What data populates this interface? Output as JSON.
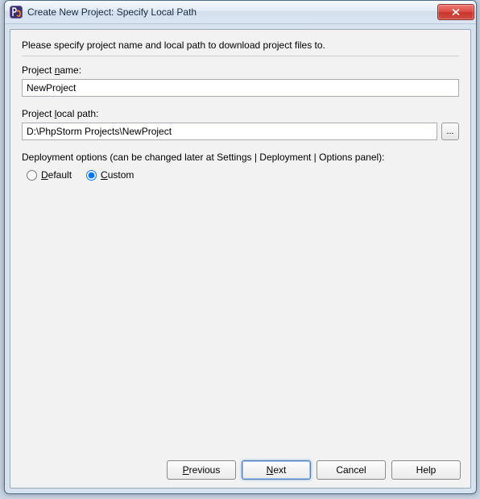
{
  "window": {
    "title": "Create New Project: Specify Local Path"
  },
  "intro": "Please specify project name and local path to download project files to.",
  "project_name": {
    "label_pre": "Project ",
    "label_mn": "n",
    "label_post": "ame:",
    "value": "NewProject"
  },
  "project_path": {
    "label_pre": "Project ",
    "label_mn": "l",
    "label_post": "ocal path:",
    "value": "D:\\PhpStorm Projects\\NewProject",
    "browse_label": "..."
  },
  "deploy": {
    "label": "Deployment options (can be changed later at Settings | Deployment | Options panel):",
    "default_mn": "D",
    "default_post": "efault",
    "custom_mn": "C",
    "custom_post": "ustom",
    "selected": "custom"
  },
  "buttons": {
    "previous_mn": "P",
    "previous_post": "revious",
    "next_mn": "N",
    "next_post": "ext",
    "cancel": "Cancel",
    "help": "Help"
  }
}
